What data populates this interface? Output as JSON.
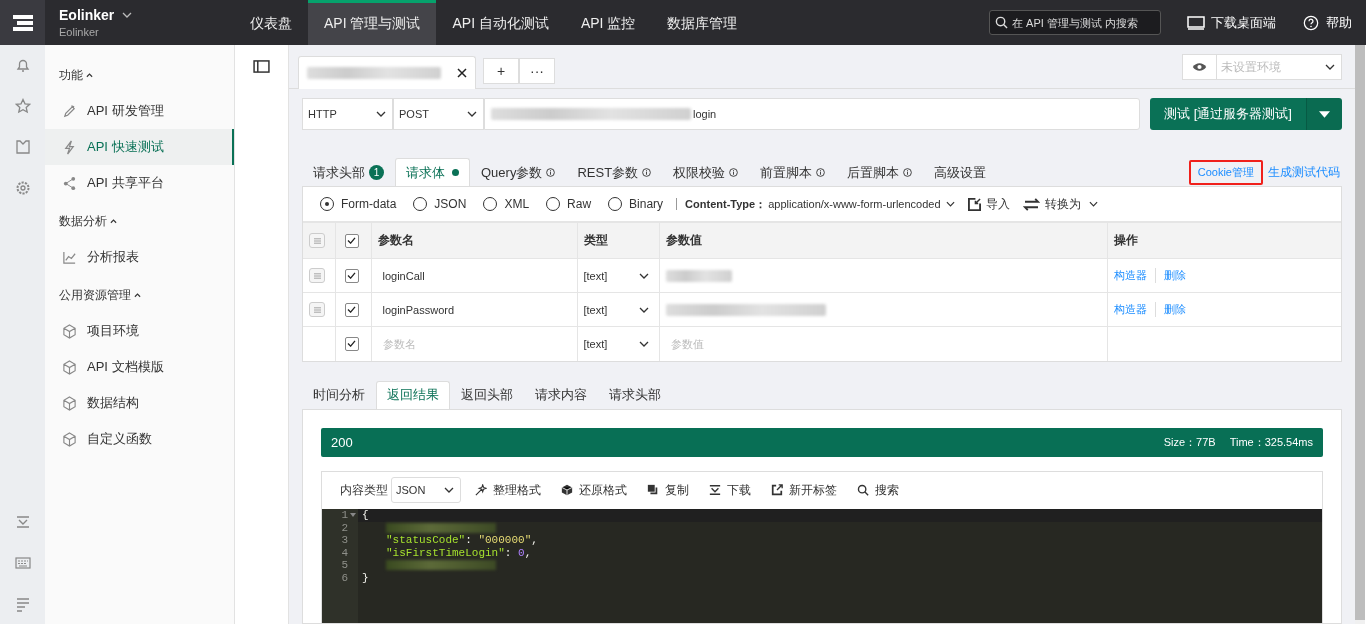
{
  "brand": {
    "name": "Eolinker",
    "subtitle": "Eolinker"
  },
  "nav": [
    {
      "label": "仪表盘",
      "selected": false
    },
    {
      "label": "API 管理与测试",
      "selected": true
    },
    {
      "label": "API 自动化测试",
      "selected": false
    },
    {
      "label": "API 监控",
      "selected": false
    },
    {
      "label": "数据库管理",
      "selected": false
    }
  ],
  "search": {
    "placeholder": "在 API 管理与测试 内搜索"
  },
  "header_actions": [
    {
      "kind": "desktop",
      "label": "下载桌面端"
    },
    {
      "kind": "help",
      "label": "帮助"
    }
  ],
  "sidebar": [
    {
      "title": "功能",
      "expanded": true,
      "items": [
        {
          "kind": "pen",
          "label": "API 研发管理",
          "selected": false
        },
        {
          "kind": "bolt",
          "label": "API 快速测试",
          "selected": true
        },
        {
          "kind": "share",
          "label": "API 共享平台",
          "selected": false
        }
      ]
    },
    {
      "title": "数据分析",
      "expanded": true,
      "items": [
        {
          "kind": "chart",
          "label": "分析报表",
          "selected": false
        }
      ]
    },
    {
      "title": "公用资源管理",
      "expanded": true,
      "items": [
        {
          "kind": "cube",
          "label": "项目环境",
          "selected": false
        },
        {
          "kind": "cube",
          "label": "API 文档模版",
          "selected": false
        },
        {
          "kind": "cube",
          "label": "数据结构",
          "selected": false
        },
        {
          "kind": "cube",
          "label": "自定义函数",
          "selected": false
        }
      ]
    }
  ],
  "tab_buttons": [
    "+",
    "···"
  ],
  "environment": {
    "placeholder": "未设置环境"
  },
  "request": {
    "protocol": "HTTP",
    "method": "POST",
    "url": "login",
    "send_button": "测试 [通过服务器测试]"
  },
  "request_tabs": [
    {
      "label": "请求头部",
      "badge": "1",
      "selected": false
    },
    {
      "label": "请求体",
      "dot": true,
      "selected": true
    },
    {
      "label": "Query参数",
      "info": true,
      "selected": false
    },
    {
      "label": "REST参数",
      "info": true,
      "selected": false
    },
    {
      "label": "权限校验",
      "info": true,
      "selected": false
    },
    {
      "label": "前置脚本",
      "info": true,
      "selected": false
    },
    {
      "label": "后置脚本",
      "info": true,
      "selected": false
    },
    {
      "label": "高级设置",
      "selected": false
    }
  ],
  "links": [
    {
      "label": "Cookie管理",
      "highlighted": true
    },
    {
      "label": "生成测试代码",
      "highlighted": false
    }
  ],
  "body_types": [
    {
      "label": "Form-data",
      "selected": true
    },
    {
      "label": "JSON",
      "selected": false
    },
    {
      "label": "XML",
      "selected": false
    },
    {
      "label": "Raw",
      "selected": false
    },
    {
      "label": "Binary",
      "selected": false
    }
  ],
  "content_type": {
    "label": "Content-Type：",
    "value": "application/x-www-form-urlencoded"
  },
  "body_actions": [
    {
      "kind": "import",
      "label": "导入"
    },
    {
      "kind": "convert",
      "label": "转换为"
    }
  ],
  "table": {
    "all_checked": true,
    "columns": [
      "参数名",
      "类型",
      "参数值",
      "操作"
    ],
    "rows": [
      {
        "name": "loginCall",
        "type": "[text]",
        "checked": true,
        "actions": [
          "构造器",
          "删除"
        ]
      },
      {
        "name": "loginPassword",
        "type": "[text]",
        "checked": true,
        "actions": [
          "构造器",
          "删除"
        ]
      }
    ],
    "new_row": {
      "name_placeholder": "参数名",
      "type": "[text]",
      "value_placeholder": "参数值",
      "checked": true
    }
  },
  "response_tabs": [
    {
      "label": "时间分析",
      "selected": false
    },
    {
      "label": "返回结果",
      "selected": true
    },
    {
      "label": "返回头部",
      "selected": false
    },
    {
      "label": "请求内容",
      "selected": false
    },
    {
      "label": "请求头部",
      "selected": false
    }
  ],
  "response": {
    "status": "200",
    "size": "Size：77B",
    "time": "Time：325.54ms"
  },
  "viewer": {
    "label": "内容类型",
    "format": "JSON",
    "actions": [
      {
        "kind": "wand",
        "label": "整理格式"
      },
      {
        "kind": "cube",
        "label": "还原格式"
      },
      {
        "kind": "copy",
        "label": "复制"
      },
      {
        "kind": "download",
        "label": "下载"
      },
      {
        "kind": "external",
        "label": "新开标签"
      },
      {
        "kind": "search",
        "label": "搜索"
      }
    ],
    "lines": [
      {
        "number": "1",
        "kind": "code",
        "tokens": [
          {
            "kind": "punct",
            "text": "{"
          }
        ]
      },
      {
        "number": "2",
        "kind": "blurred"
      },
      {
        "number": "3",
        "kind": "code",
        "tokens": [
          {
            "kind": "key",
            "text": "\"statusCode\""
          },
          {
            "kind": "punct",
            "text": ": "
          },
          {
            "kind": "string",
            "text": "\"000000\""
          },
          {
            "kind": "punct",
            "text": ","
          }
        ]
      },
      {
        "number": "4",
        "kind": "code",
        "tokens": [
          {
            "kind": "key",
            "text": "\"isFirstTimeLogin\""
          },
          {
            "kind": "punct",
            "text": ": "
          },
          {
            "kind": "number",
            "text": "0"
          },
          {
            "kind": "punct",
            "text": ","
          }
        ]
      },
      {
        "number": "5",
        "kind": "blurred"
      },
      {
        "number": "6",
        "kind": "code",
        "tokens": [
          {
            "kind": "punct",
            "text": "}"
          }
        ]
      }
    ]
  }
}
